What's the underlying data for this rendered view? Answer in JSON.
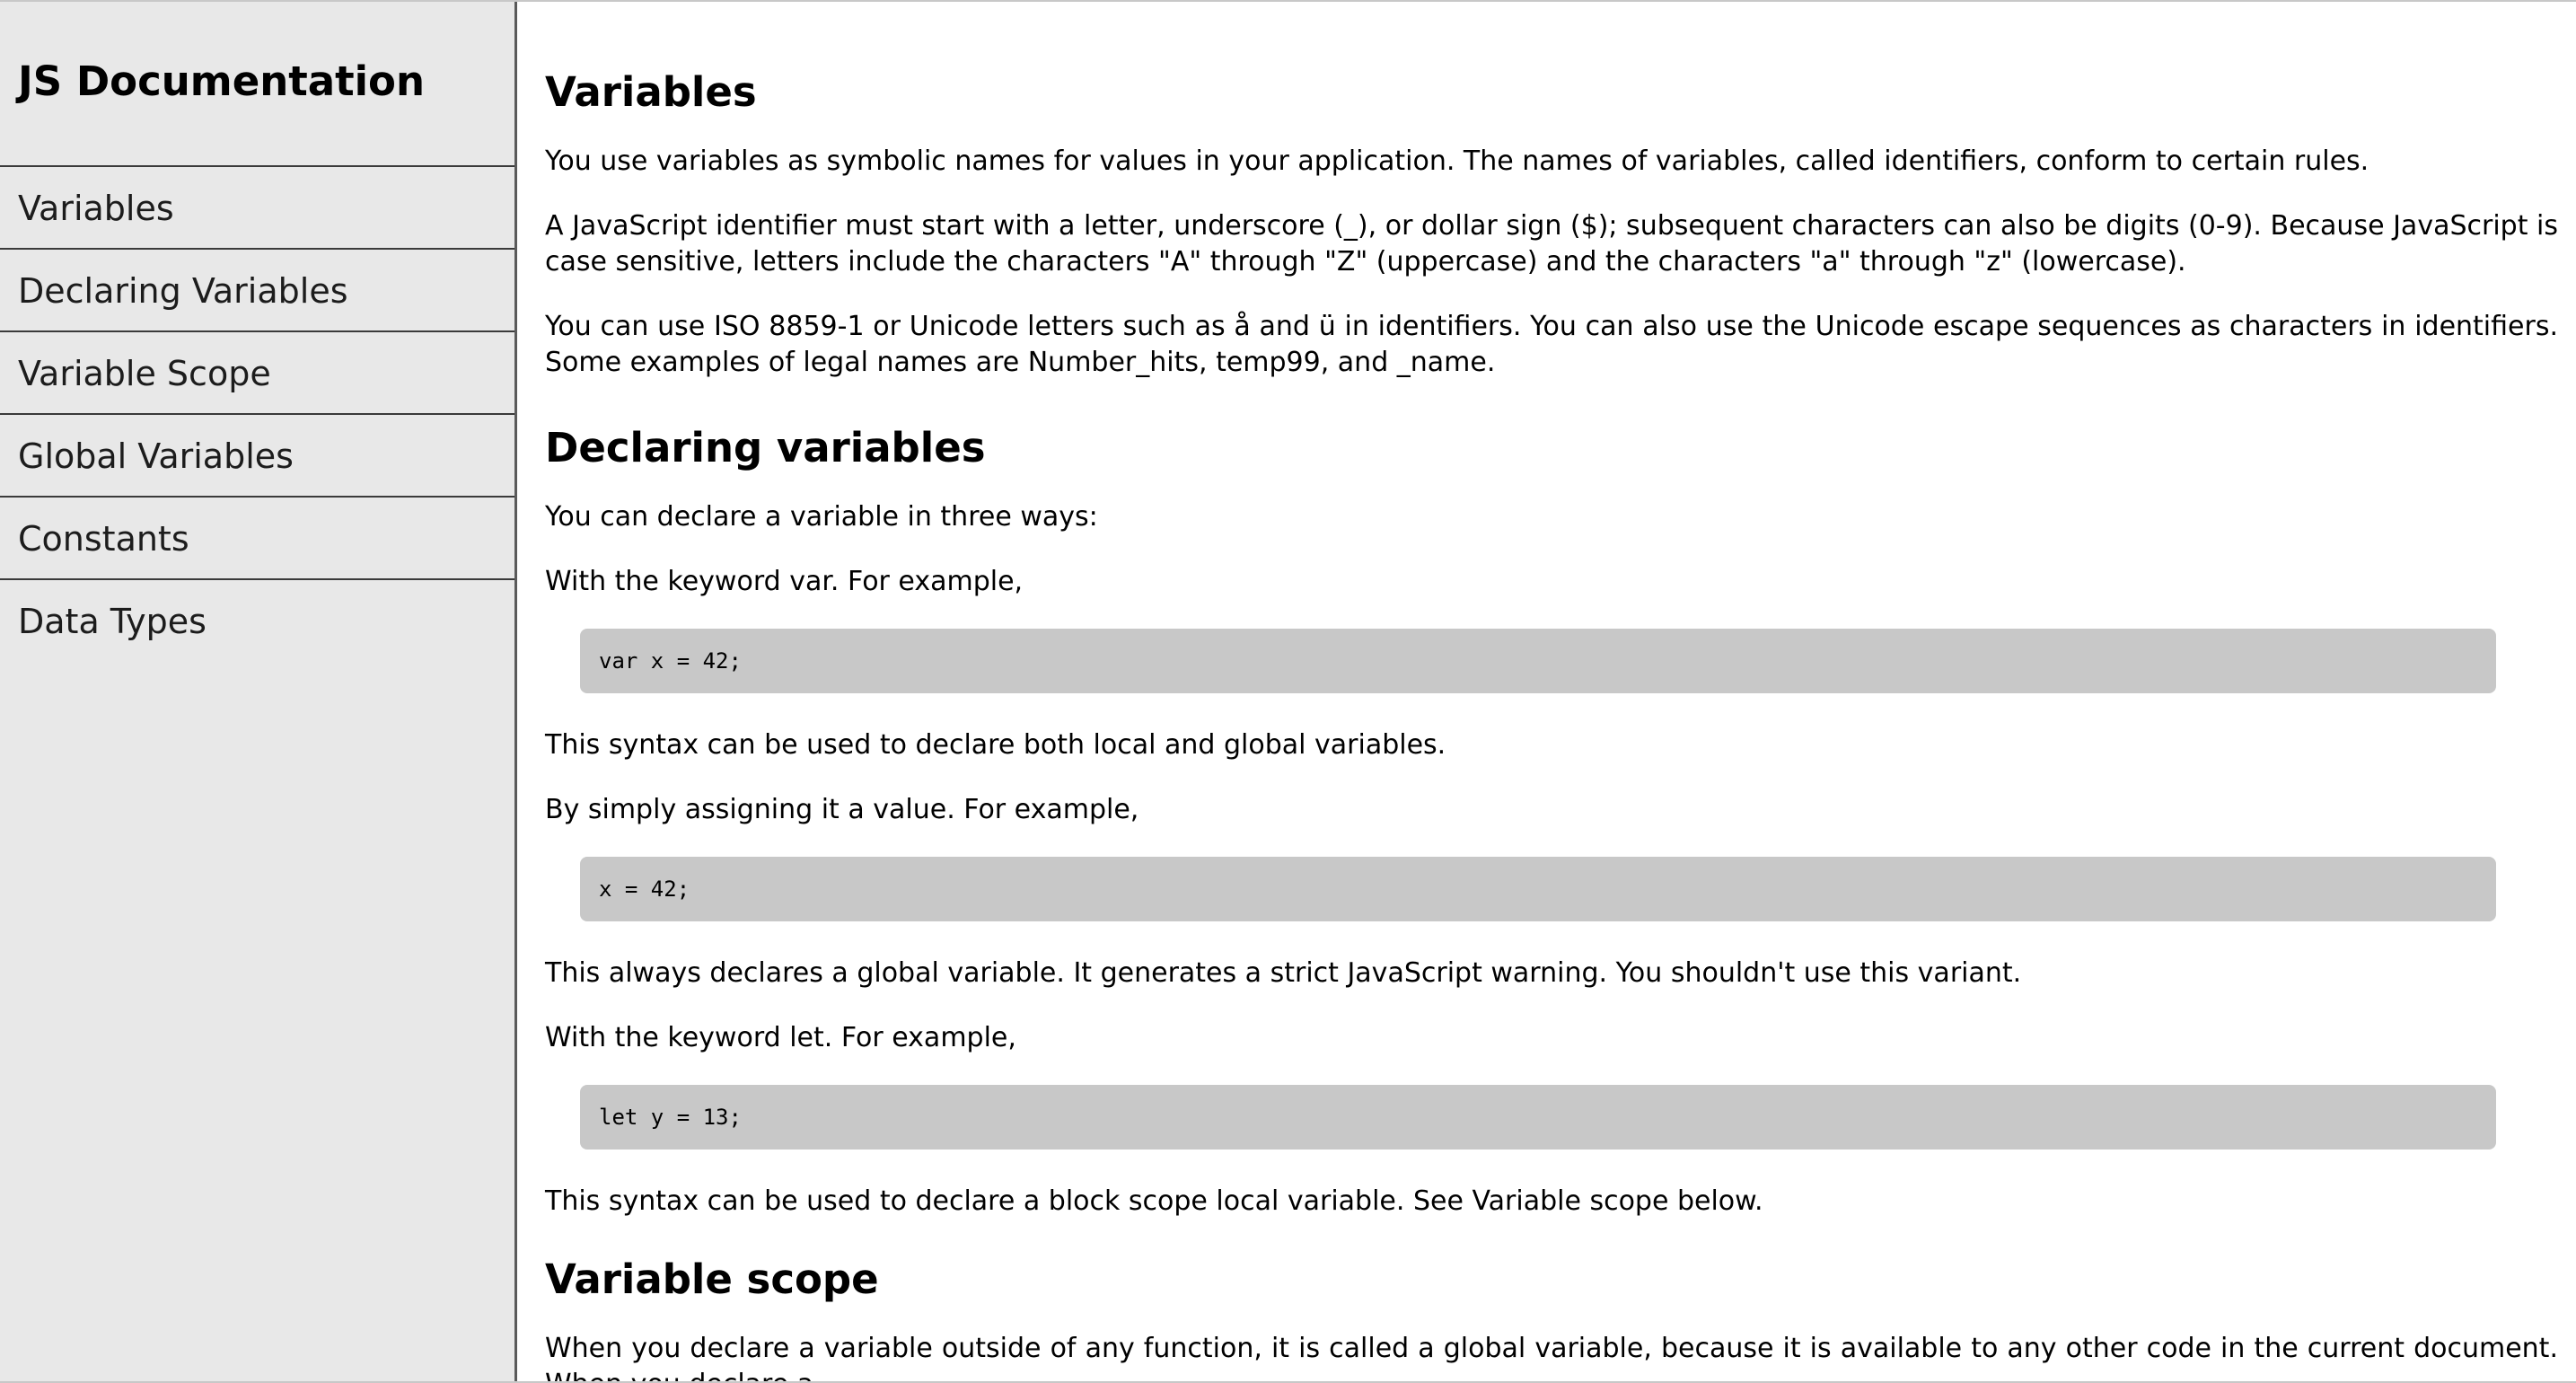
{
  "navbar": {
    "title": "JS Documentation",
    "links": [
      {
        "label": "Variables"
      },
      {
        "label": "Declaring Variables"
      },
      {
        "label": "Variable Scope"
      },
      {
        "label": "Global Variables"
      },
      {
        "label": "Constants"
      },
      {
        "label": "Data Types"
      }
    ]
  },
  "main": {
    "variables": {
      "heading": "Variables",
      "paragraphs": [
        "You use variables as symbolic names for values in your application. The names of variables, called identifiers, conform to certain rules.",
        "A JavaScript identifier must start with a letter, underscore (_), or dollar sign ($); subsequent characters can also be digits (0-9). Because JavaScript is case sensitive, letters include the characters \"A\" through \"Z\" (uppercase) and the characters \"a\" through \"z\" (lowercase).",
        "You can use ISO 8859-1 or Unicode letters such as å and ü in identifiers. You can also use the Unicode escape sequences as characters in identifiers. Some examples of legal names are Number_hits, temp99, and _name."
      ]
    },
    "declaring": {
      "heading": "Declaring variables",
      "intro": "You can declare a variable in three ways:",
      "var_text": "With the keyword var. For example,",
      "var_code": "var x = 42;",
      "var_note": "This syntax can be used to declare both local and global variables.",
      "assign_text": "By simply assigning it a value. For example,",
      "assign_code": "x = 42;",
      "assign_note": "This always declares a global variable. It generates a strict JavaScript warning. You shouldn't use this variant.",
      "let_text": "With the keyword let. For example,",
      "let_code": "let y = 13;",
      "let_note": "This syntax can be used to declare a block scope local variable. See Variable scope below."
    },
    "scope": {
      "heading": "Variable scope",
      "paragraph": "When you declare a variable outside of any function, it is called a global variable, because it is available to any other code in the current document. When you declare a"
    }
  }
}
